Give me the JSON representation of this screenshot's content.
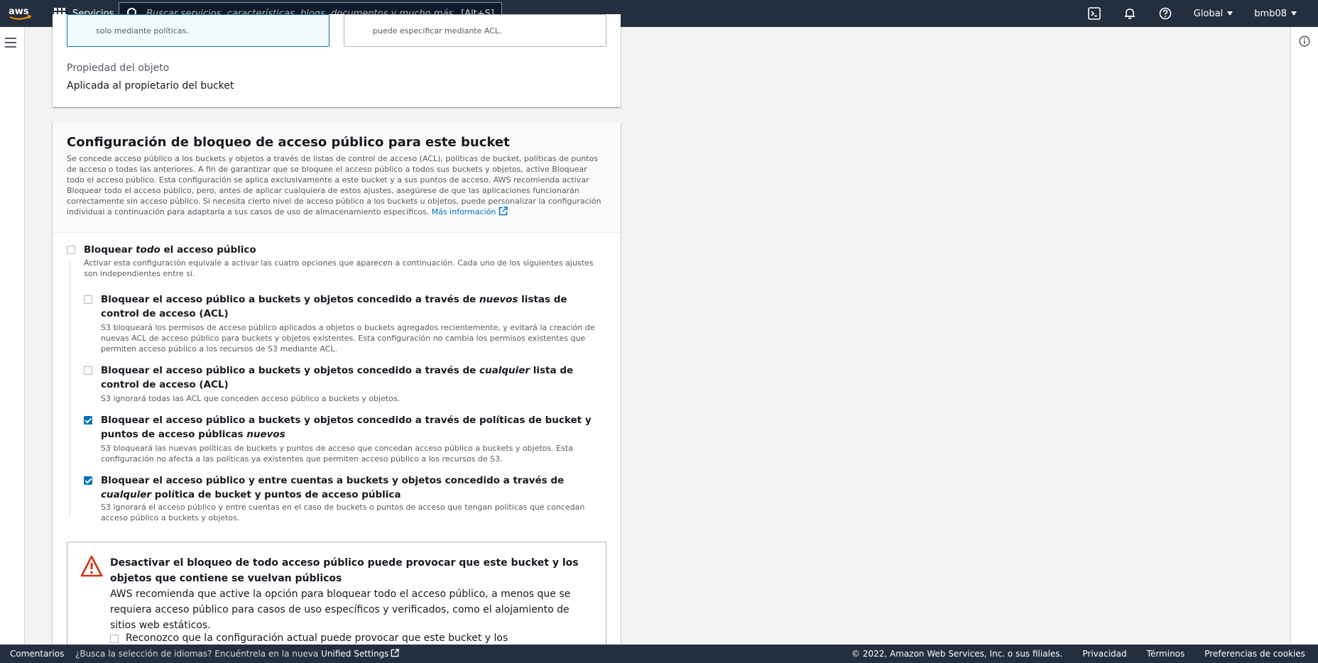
{
  "nav": {
    "services_label": "Servicios",
    "search_placeholder": "Buscar servicios, características, blogs, documentos y mucho más",
    "search_shortcut": "[Alt+S]",
    "region_label": "Global",
    "user_label": "bmb08"
  },
  "ownership_card": {
    "tile1_text": "solo mediante políticas.",
    "tile2_text": "puede especificar mediante ACL.",
    "property_label": "Propiedad del objeto",
    "property_value": "Aplicada al propietario del bucket"
  },
  "block_card": {
    "title": "Configuración de bloqueo de acceso público para este bucket",
    "description": "Se concede acceso público a los buckets y objetos a través de listas de control de acceso (ACL), políticas de bucket, políticas de puntos de acceso o todas las anteriores. A fin de garantizar que se bloquee el acceso público a todos sus buckets y objetos, active Bloquear todo el acceso público. Esta configuración se aplica exclusivamente a este bucket y a sus puntos de acceso. AWS recomienda activar Bloquear todo el acceso público, pero, antes de aplicar cualquiera de estos ajustes, asegúrese de que las aplicaciones funcionarán correctamente sin acceso público. Si necesita cierto nivel de acceso público a los buckets u objetos, puede personalizar la configuración individual a continuación para adaptarla a sus casos de uso de almacenamiento específicos.",
    "more_info_link": "Más información",
    "block_all": {
      "title_pre": "Bloquear ",
      "title_em": "todo",
      "title_post": " el acceso público",
      "description": "Activar esta configuración equivale a activar las cuatro opciones que aparecen a continuación. Cada uno de los siguientes ajustes son independientes entre sí.",
      "checked": false
    },
    "options": [
      {
        "title_pre": "Bloquear el acceso público a buckets y objetos concedido a través de ",
        "title_em": "nuevos",
        "title_post": " listas de control de acceso (ACL)",
        "description": "S3 bloqueará los permisos de acceso público aplicados a objetos o buckets agregados recientemente, y evitará la creación de nuevas ACL de acceso público para buckets y objetos existentes. Esta configuración no cambia los permisos existentes que permiten acceso público a los recursos de S3 mediante ACL.",
        "checked": false
      },
      {
        "title_pre": "Bloquear el acceso público a buckets y objetos concedido a través de ",
        "title_em": "cualquier",
        "title_post": " lista de control de acceso (ACL)",
        "description": "S3 ignorará todas las ACL que conceden acceso público a buckets y objetos.",
        "checked": false
      },
      {
        "title_pre": "Bloquear el acceso público a buckets y objetos concedido a través de políticas de bucket y puntos de acceso públicas ",
        "title_em": "nuevos",
        "title_post": "",
        "description": "S3 bloqueará las nuevas políticas de buckets y puntos de acceso que concedan acceso público a buckets y objetos. Esta configuración no afecta a las políticas ya existentes que permiten acceso público a los recursos de S3.",
        "checked": true
      },
      {
        "title_pre": "Bloquear el acceso público y entre cuentas a buckets y objetos concedido a través de ",
        "title_em": "cualquier",
        "title_post": " política de bucket y puntos de acceso pública",
        "description": "S3 ignorará el acceso público y entre cuentas en el caso de buckets o puntos de acceso que tengan políticas que concedan acceso público a buckets y objetos.",
        "checked": true
      }
    ],
    "warning": {
      "title": "Desactivar el bloqueo de todo acceso público puede provocar que este bucket y los objetos que contiene se vuelvan públicos",
      "text": "AWS recomienda que active la opción para bloquear todo el acceso público, a menos que se requiera acceso público para casos de uso específicos y verificados, como el alojamiento de sitios web estáticos.",
      "ack_text": "Reconozco que la configuración actual puede provocar que este bucket y los",
      "ack_checked": false
    }
  },
  "footer": {
    "feedback": "Comentarios",
    "lang_text": "¿Busca la selección de idiomas? Encuéntrela en la nueva ",
    "lang_link": "Unified Settings",
    "copyright": "© 2022, Amazon Web Services, Inc. o sus filiales.",
    "privacy": "Privacidad",
    "terms": "Términos",
    "cookies": "Preferencias de cookies"
  },
  "colors": {
    "nav_bg": "#232f3e",
    "accent": "#0073bb",
    "warning": "#d13212"
  }
}
